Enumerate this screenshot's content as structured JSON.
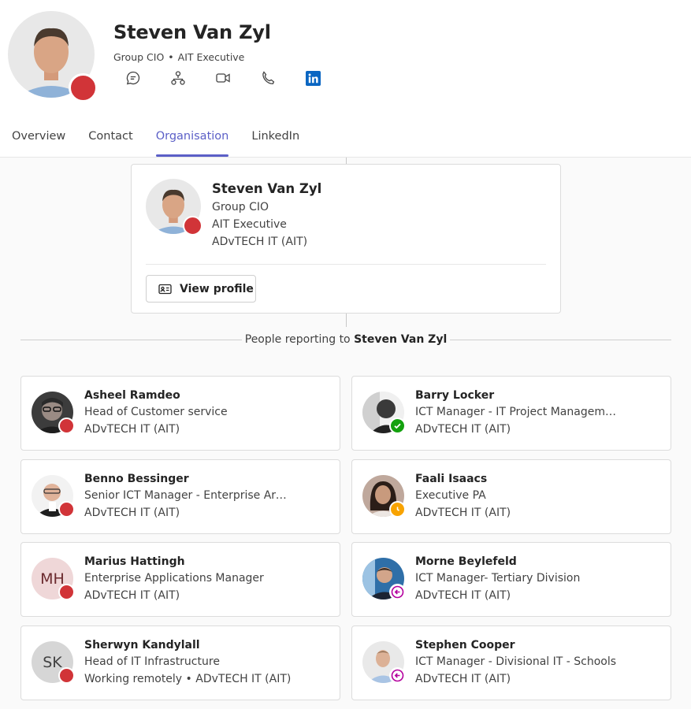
{
  "profile": {
    "name": "Steven Van Zyl",
    "job_title": "Group CIO",
    "department": "AIT Executive",
    "separator": "•",
    "presence": "busy"
  },
  "actions": [
    {
      "icon": "chat-icon"
    },
    {
      "icon": "org-chart-icon"
    },
    {
      "icon": "video-call-icon"
    },
    {
      "icon": "phone-call-icon"
    },
    {
      "icon": "linkedin-icon",
      "color": "#0a66c2"
    }
  ],
  "tabs": [
    {
      "label": "Overview",
      "active": false
    },
    {
      "label": "Contact",
      "active": false
    },
    {
      "label": "Organisation",
      "active": true
    },
    {
      "label": "LinkedIn",
      "active": false
    }
  ],
  "manager_card": {
    "name": "Steven Van Zyl",
    "job_title": "Group CIO",
    "department": "AIT Executive",
    "company": "ADvTECH IT (AIT)",
    "view_profile_label": "View profile",
    "view_profile_icon": "contact-card-icon"
  },
  "reports_header": {
    "prefix": "People reporting to",
    "name": "Steven Van Zyl"
  },
  "reports": [
    {
      "name": "Asheel Ramdeo",
      "title": "Head of Customer service",
      "org": "ADvTECH IT (AIT)",
      "presence": "busy",
      "avatar": "photo"
    },
    {
      "name": "Barry Locker",
      "title": "ICT Manager - IT Project Management",
      "org": "ADvTECH IT (AIT)",
      "presence": "available",
      "avatar": "photo"
    },
    {
      "name": "Benno Bessinger",
      "title": "Senior ICT Manager - Enterprise Architecture",
      "org": "ADvTECH IT (AIT)",
      "presence": "busy",
      "avatar": "photo"
    },
    {
      "name": "Faali Isaacs",
      "title": "Executive PA",
      "org": "ADvTECH IT (AIT)",
      "presence": "away",
      "avatar": "photo"
    },
    {
      "name": "Marius Hattingh",
      "title": "Enterprise Applications Manager",
      "org": "ADvTECH IT (AIT)",
      "presence": "busy",
      "avatar": "initials",
      "initials": "MH"
    },
    {
      "name": "Morne Beylefeld",
      "title": "ICT Manager- Tertiary Division",
      "org": "ADvTECH IT (AIT)",
      "presence": "out-of-office",
      "avatar": "photo"
    },
    {
      "name": "Sherwyn Kandylall",
      "title": "Head of IT Infrastructure",
      "org": "Working remotely • ADvTECH IT (AIT)",
      "presence": "busy",
      "avatar": "initials",
      "initials": "SK"
    },
    {
      "name": "Stephen Cooper",
      "title": "ICT Manager - Divisional IT - Schools",
      "org": "ADvTECH IT (AIT)",
      "presence": "out-of-office",
      "avatar": "photo"
    }
  ],
  "colors": {
    "accent": "#5b5fc7",
    "busy": "#d13438",
    "available": "#13a10e",
    "away": "#f8a300",
    "out_of_office": "#b4009e"
  }
}
